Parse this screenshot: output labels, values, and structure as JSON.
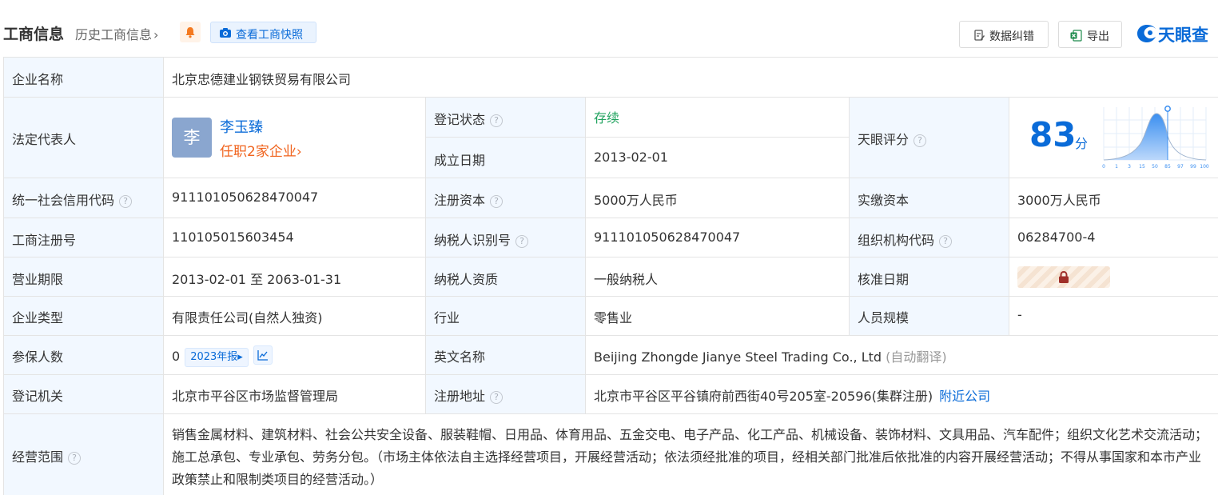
{
  "header": {
    "title": "工商信息",
    "history_link": "历史工商信息",
    "history_chevron": "›",
    "snapshot_button": "查看工商快照",
    "correction_button": "数据纠错",
    "export_button": "导出",
    "logo_text": "天眼查",
    "icons": [
      "bell-icon",
      "camera-icon",
      "edit-doc-icon",
      "excel-icon",
      "tianyancha-logo-icon"
    ]
  },
  "table": {
    "company_name_label": "企业名称",
    "company_name": "北京忠德建业钢铁贸易有限公司",
    "legal_rep_label": "法定代表人",
    "legal_rep_avatar": "李",
    "legal_rep_name": "李玉臻",
    "legal_rep_jobs": "任职2家企业",
    "legal_rep_jobs_chevron": "›",
    "reg_status_label": "登记状态",
    "reg_status": "存续",
    "established_label": "成立日期",
    "established": "2013-02-01",
    "score_label": "天眼评分",
    "score_value": "83",
    "score_unit": "分",
    "score_axis_ticks": [
      "0",
      "1",
      "3",
      "15",
      "50",
      "85",
      "97",
      "99",
      "100"
    ],
    "uscc_label": "统一社会信用代码",
    "uscc": "911101050628470047",
    "registered_capital_label": "注册资本",
    "registered_capital": "5000万人民币",
    "paidin_capital_label": "实缴资本",
    "paidin_capital": "3000万人民币",
    "business_reg_no_label": "工商注册号",
    "business_reg_no": "110105015603454",
    "taxpayer_id_label": "纳税人识别号",
    "taxpayer_id": "911101050628470047",
    "org_code_label": "组织机构代码",
    "org_code": "06284700-4",
    "business_term_label": "营业期限",
    "business_term": "2013-02-01 至 2063-01-31",
    "taxpayer_quality_label": "纳税人资质",
    "taxpayer_quality": "一般纳税人",
    "approval_date_label": "核准日期",
    "company_type_label": "企业类型",
    "company_type": "有限责任公司(自然人独资)",
    "industry_label": "行业",
    "industry": "零售业",
    "staff_size_label": "人员规模",
    "staff_size": "-",
    "insured_label": "参保人数",
    "insured_count": "0",
    "insured_report": "2023年报",
    "insured_report_arrow": "▸",
    "english_name_label": "英文名称",
    "english_name": "Beijing Zhongde Jianye Steel Trading Co., Ltd",
    "english_name_note": "(自动翻译)",
    "reg_authority_label": "登记机关",
    "reg_authority": "北京市平谷区市场监督管理局",
    "reg_address_label": "注册地址",
    "reg_address": "北京市平谷区平谷镇府前西街40号205室-20596(集群注册)",
    "nearby_link": "附近公司",
    "scope_label": "经营范围",
    "scope": "销售金属材料、建筑材料、社会公共安全设备、服装鞋帽、日用品、体育用品、五金交电、电子产品、化工产品、机械设备、装饰材料、文具用品、汽车配件；组织文化艺术交流活动；施工总承包、专业承包、劳务分包。（市场主体依法自主选择经营项目，开展经营活动；依法须经批准的项目，经相关部门批准后依批准的内容开展经营活动；不得从事国家和本市产业政策禁止和限制类项目的经营活动。）",
    "help_symbol": "?"
  },
  "colors": {
    "accent": "#0a6bd8",
    "label_bg": "#f2f8ff",
    "status_green": "#21a35f",
    "orange": "#f0641e"
  }
}
